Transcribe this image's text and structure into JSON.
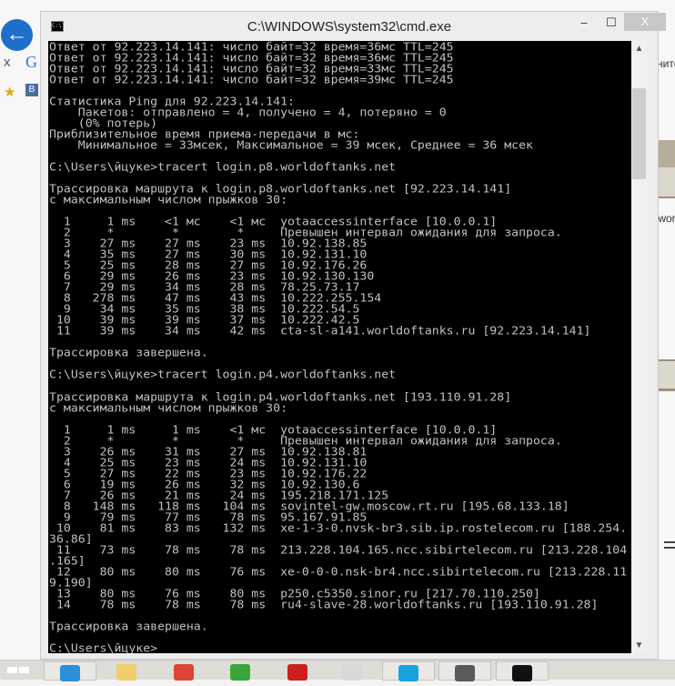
{
  "window": {
    "title": "C:\\WINDOWS\\system32\\cmd.exe",
    "min_icon": "minimize-icon",
    "max_icon": "maximize-icon",
    "close_label": "X"
  },
  "browser": {
    "back_icon": "←",
    "tab_close": "x",
    "google_glyph": "G",
    "vk_glyph": "B",
    "right_text_1": "ните",
    "right_text_2": ".wor"
  },
  "console": {
    "lines": [
      "Ответ от 92.223.14.141: число байт=32 время=36мс TTL=245",
      "Ответ от 92.223.14.141: число байт=32 время=36мс TTL=245",
      "Ответ от 92.223.14.141: число байт=32 время=33мс TTL=245",
      "Ответ от 92.223.14.141: число байт=32 время=39мс TTL=245",
      "",
      "Статистика Ping для 92.223.14.141:",
      "    Пакетов: отправлено = 4, получено = 4, потеряно = 0",
      "    (0% потерь)",
      "Приблизительное время приема-передачи в мс:",
      "    Минимальное = 33мсек, Максимальное = 39 мсек, Среднее = 36 мсек",
      "",
      "C:\\Users\\йцуке>tracert login.p8.worldoftanks.net",
      "",
      "Трассировка маршрута к login.p8.worldoftanks.net [92.223.14.141]",
      "с максимальным числом прыжков 30:",
      "",
      "  1     1 ms    <1 мс    <1 мс  yotaaccessinterface [10.0.0.1]",
      "  2     *        *        *     Превышен интервал ожидания для запроса.",
      "  3    27 ms    27 ms    23 ms  10.92.138.85",
      "  4    35 ms    27 ms    30 ms  10.92.131.10",
      "  5    25 ms    28 ms    27 ms  10.92.176.26",
      "  6    29 ms    26 ms    23 ms  10.92.130.130",
      "  7    29 ms    34 ms    28 ms  78.25.73.17",
      "  8   278 ms    47 ms    43 ms  10.222.255.154",
      "  9    34 ms    35 ms    38 ms  10.222.54.5",
      " 10    39 ms    39 ms    37 ms  10.222.42.5",
      " 11    39 ms    34 ms    42 ms  cta-sl-a141.worldoftanks.ru [92.223.14.141]",
      "",
      "Трассировка завершена.",
      "",
      "C:\\Users\\йцуке>tracert login.p4.worldoftanks.net",
      "",
      "Трассировка маршрута к login.p4.worldoftanks.net [193.110.91.28]",
      "с максимальным числом прыжков 30:",
      "",
      "  1     1 ms     1 ms    <1 мс  yotaaccessinterface [10.0.0.1]",
      "  2     *        *        *     Превышен интервал ожидания для запроса.",
      "  3    26 ms    31 ms    27 ms  10.92.138.81",
      "  4    25 ms    23 ms    24 ms  10.92.131.10",
      "  5    27 ms    22 ms    23 ms  10.92.176.22",
      "  6    19 ms    26 ms    32 ms  10.92.130.6",
      "  7    26 ms    21 ms    24 ms  195.218.171.125",
      "  8   148 ms   118 ms   104 ms  sovintel-gw.moscow.rt.ru [195.68.133.18]",
      "  9    79 ms    77 ms    78 ms  95.167.91.85",
      " 10    81 ms    83 ms   132 ms  xe-1-3-0.nvsk-br3.sib.ip.rostelecom.ru [188.254.",
      "36.86]",
      " 11    73 ms    78 ms    78 ms  213.228.104.165.ncc.sibirtelecom.ru [213.228.104",
      ".165]",
      " 12    80 ms    80 ms    76 ms  xe-0-0-0.nsk-br4.ncc.sibirtelecom.ru [213.228.11",
      "9.190]",
      " 13    80 ms    76 ms    80 ms  p250.c5350.sinor.ru [217.70.110.250]",
      " 14    78 ms    78 ms    78 ms  ru4-slave-28.worldoftanks.ru [193.110.91.28]",
      "",
      "Трассировка завершена.",
      "",
      "C:\\Users\\йцуке>"
    ]
  },
  "taskbar": {
    "items": [
      {
        "name": "internet-explorer-icon",
        "color": "#2b8fd9"
      },
      {
        "name": "file-explorer-icon",
        "color": "#f0cf6b"
      },
      {
        "name": "chrome-icon",
        "color": "#db4437"
      },
      {
        "name": "utorrent-icon",
        "color": "#3aa63a"
      },
      {
        "name": "acrobat-reader-icon",
        "color": "#cc1f1f"
      },
      {
        "name": "opera-icon",
        "color": "#d9d9d9"
      },
      {
        "name": "skype-icon",
        "color": "#1aa2e0"
      },
      {
        "name": "world-of-tanks-icon",
        "color": "#5a5a5a"
      },
      {
        "name": "cmd-icon",
        "color": "#111111"
      }
    ]
  }
}
